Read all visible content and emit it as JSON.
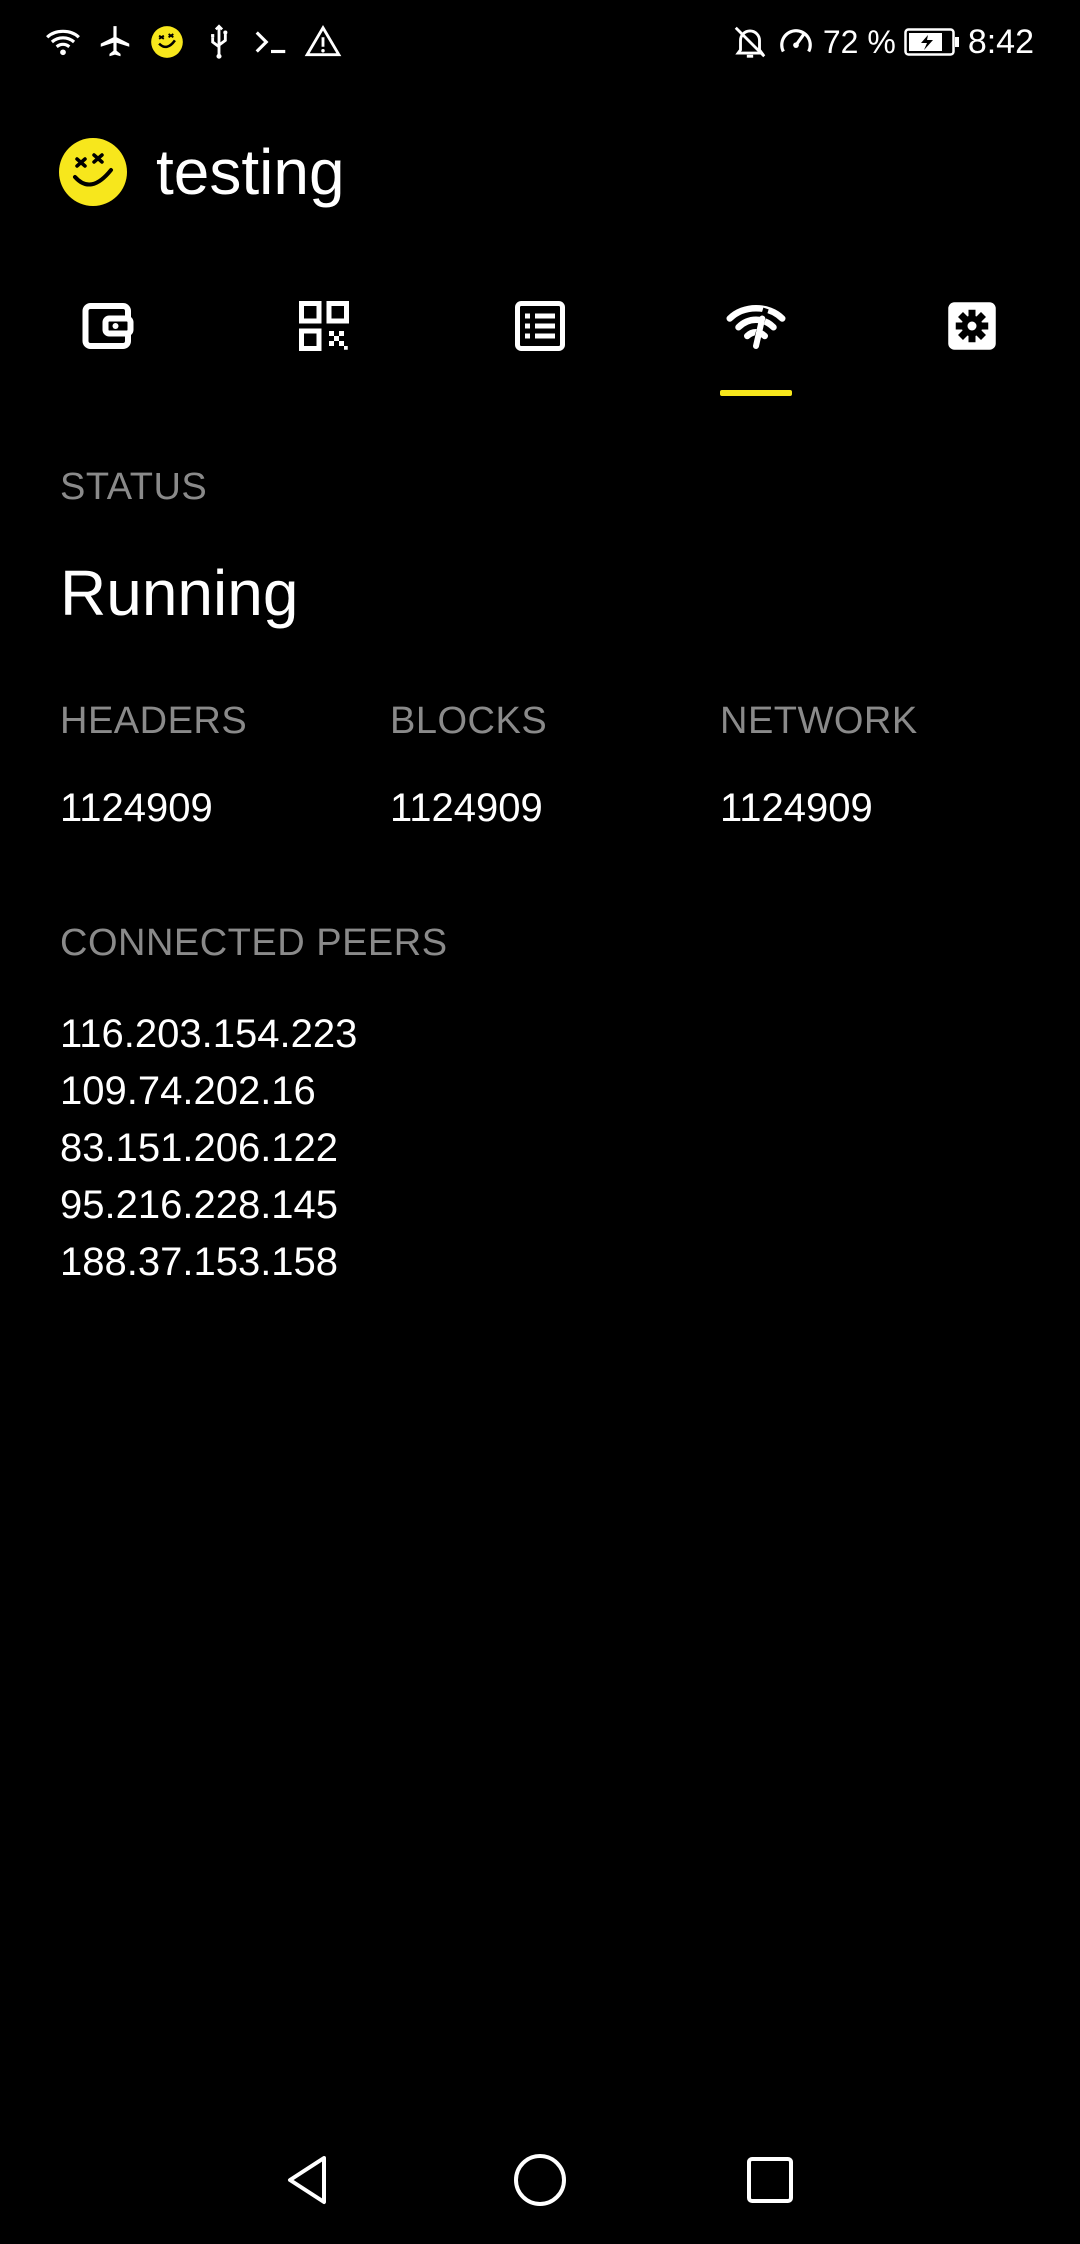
{
  "status_bar": {
    "left_icons": [
      "wifi-icon",
      "airplane-icon",
      "app-face-icon",
      "usb-icon",
      "terminal-icon",
      "warning-icon"
    ],
    "right_icons": [
      "bell-off-icon",
      "speedometer-icon",
      "battery-charging-icon"
    ],
    "battery_percent": "72 %",
    "time": "8:42"
  },
  "header": {
    "logo_icon": "smiley-logo-icon",
    "title": "testing"
  },
  "tabs": [
    {
      "icon": "wallet-icon",
      "active": false
    },
    {
      "icon": "qr-code-icon",
      "active": false
    },
    {
      "icon": "list-icon",
      "active": false
    },
    {
      "icon": "network-signal-icon",
      "active": true
    },
    {
      "icon": "settings-gear-icon",
      "active": false
    }
  ],
  "accent_color": "#f7e71c",
  "status": {
    "label": "STATUS",
    "value": "Running"
  },
  "stats": {
    "headers": {
      "label": "HEADERS",
      "value": "1124909"
    },
    "blocks": {
      "label": "BLOCKS",
      "value": "1124909"
    },
    "network": {
      "label": "NETWORK",
      "value": "1124909"
    }
  },
  "peers": {
    "label": "CONNECTED PEERS",
    "list": [
      "116.203.154.223",
      "109.74.202.16",
      "83.151.206.122",
      "95.216.228.145",
      "188.37.153.158"
    ]
  },
  "nav": [
    "back-icon",
    "home-icon",
    "recents-icon"
  ]
}
